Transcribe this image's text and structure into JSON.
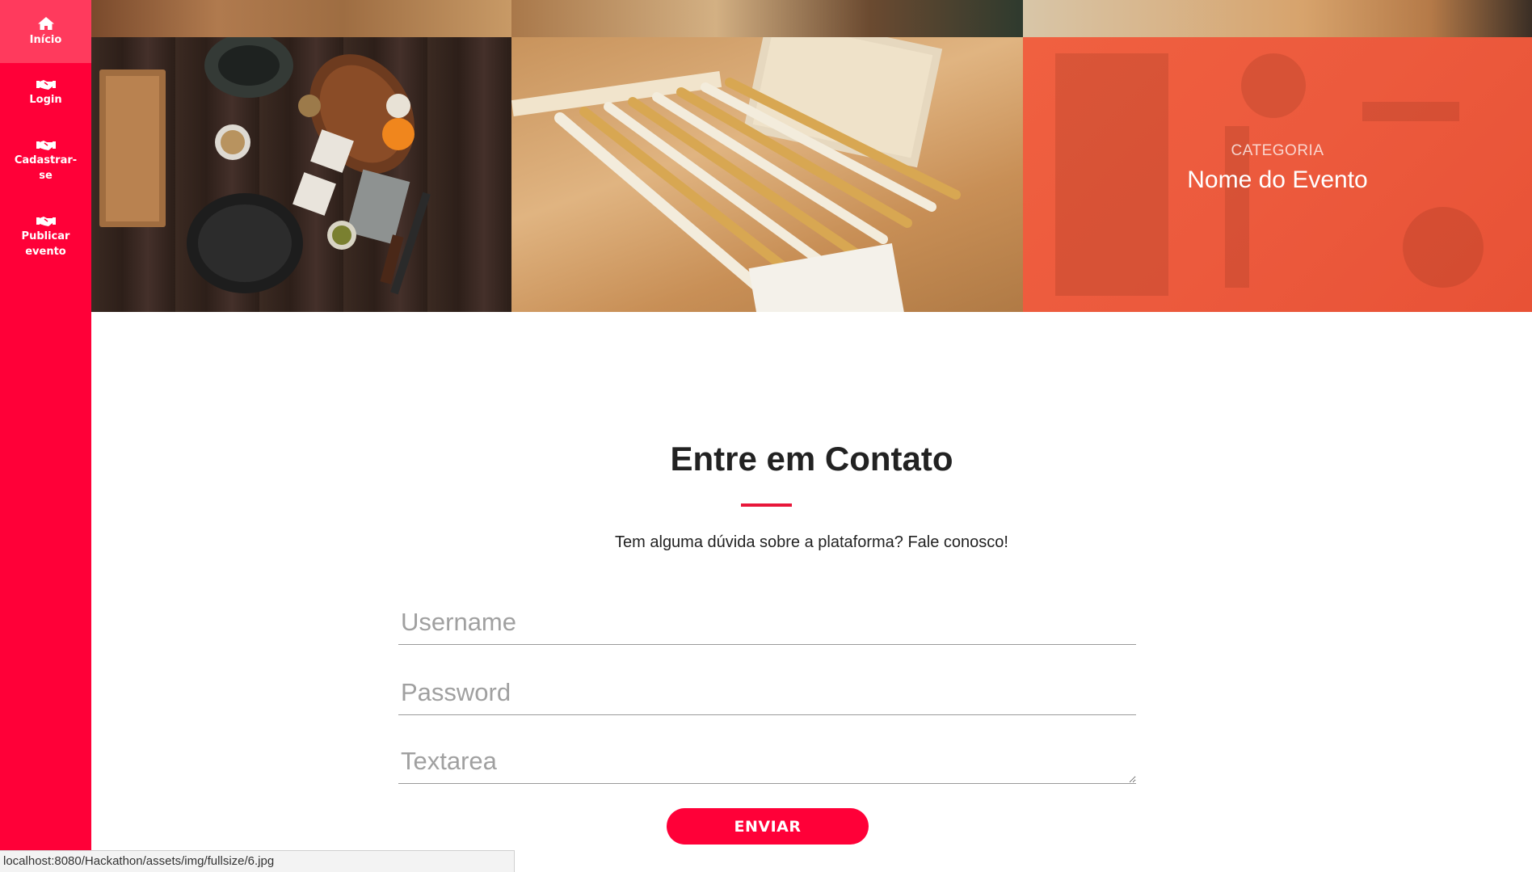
{
  "sidebar": {
    "items": [
      {
        "label": "Início",
        "icon": "home-icon"
      },
      {
        "label": "Login",
        "icon": "handshake-icon"
      },
      {
        "label": "Cadastrar-\nse",
        "icon": "handshake-icon"
      },
      {
        "label": "Publicar\nevento",
        "icon": "handshake-icon"
      }
    ],
    "color": "#ff0038"
  },
  "featured_event": {
    "category": "CATEGORIA",
    "name": "Nome do Evento",
    "overlay_color": "#ec5a3d"
  },
  "contact": {
    "title": "Entre em Contato",
    "subtitle": "Tem alguma dúvida sobre a plataforma? Fale conosco!",
    "username_placeholder": "Username",
    "password_placeholder": "Password",
    "textarea_placeholder": "Textarea",
    "submit_label": "ENVIAR",
    "accent_color": "#e8173a"
  },
  "status_bar": {
    "url": "localhost:8080/Hackathon/assets/img/fullsize/6.jpg"
  }
}
